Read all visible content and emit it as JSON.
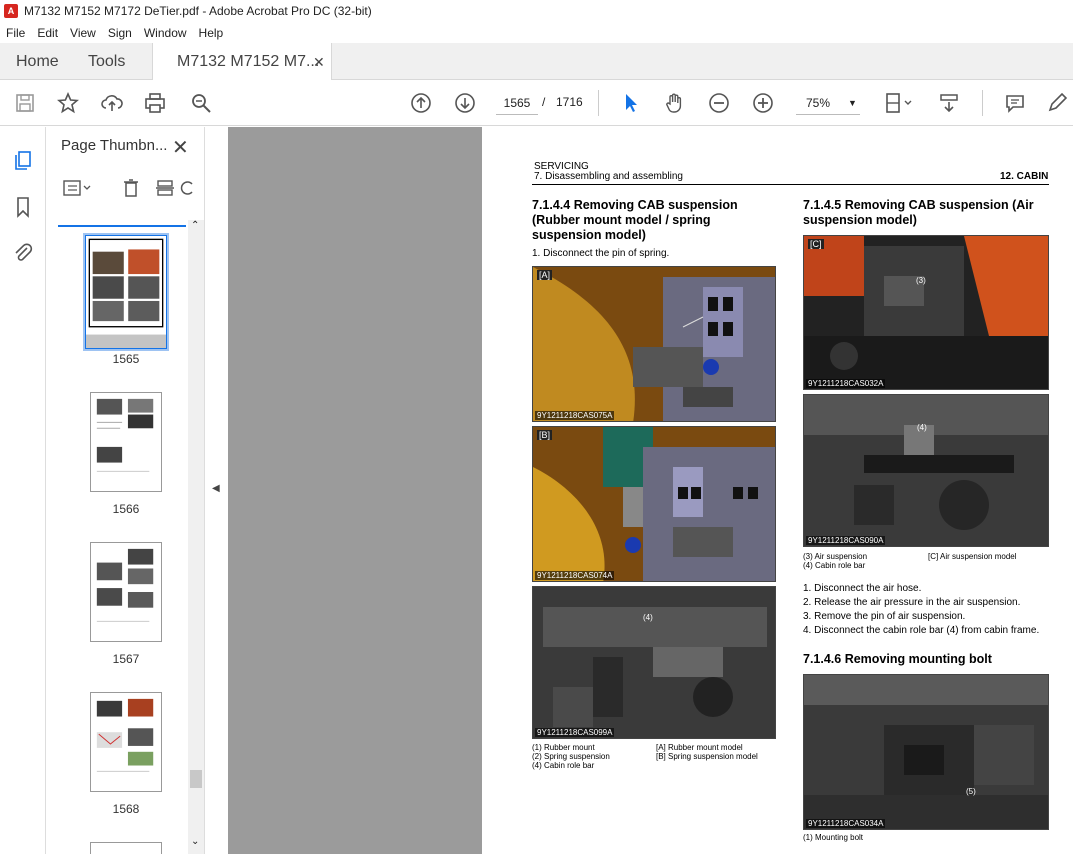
{
  "window": {
    "title": "M7132 M7152 M7172 DeTier.pdf - Adobe Acrobat Pro DC (32-bit)"
  },
  "menu": [
    "File",
    "Edit",
    "View",
    "Sign",
    "Window",
    "Help"
  ],
  "tabs": {
    "home": "Home",
    "tools": "Tools",
    "doc": "M7132 M7152 M7..."
  },
  "toolbar": {
    "current_page": "1565",
    "page_sep": "/",
    "total_pages": "1716",
    "zoom": "75%"
  },
  "panel": {
    "title": "Page Thumbn...",
    "thumbnails": [
      {
        "label": "1565"
      },
      {
        "label": "1566"
      },
      {
        "label": "1567"
      },
      {
        "label": "1568"
      }
    ]
  },
  "doc": {
    "header_left1": "SERVICING",
    "header_left2": "7. Disassembling and assembling",
    "header_right": "12. CABIN",
    "sec1_title": "7.1.4.4 Removing CAB suspension (Rubber mount model / spring suspension model)",
    "sec1_step": "1.   Disconnect the pin of spring.",
    "photoA": {
      "tag": "[A]",
      "code": "9Y1211218CAS075A"
    },
    "photoB": {
      "tag": "[B]",
      "code": "9Y1211218CAS074A"
    },
    "photoC1": {
      "tag": "",
      "code": "9Y1211218CAS099A",
      "callout": "(4)"
    },
    "legend1": [
      "(1)   Rubber mount",
      "(2)   Spring suspension",
      "(4)   Cabin role bar"
    ],
    "legend1b": [
      "[A]   Rubber mount model",
      "[B]   Spring suspension model"
    ],
    "sec2_title": "7.1.4.5 Removing CAB suspension (Air suspension model)",
    "photoC": {
      "tag": "[C]",
      "code": "9Y1211218CAS032A",
      "callout": "(3)"
    },
    "photoD": {
      "tag": "",
      "code": "9Y1211218CAS090A",
      "callout": "(4)"
    },
    "legend2": [
      "(3)   Air suspension",
      "(4)   Cabin role bar"
    ],
    "legend2b": [
      "[C]   Air suspension model"
    ],
    "steps2": [
      "1.   Disconnect the air hose.",
      "2.   Release the air pressure in the air suspension.",
      "3.   Remove the pin of air suspension.",
      "4.   Disconnect the cabin role bar (4) from cabin frame."
    ],
    "sec3_title": "7.1.4.6 Removing mounting bolt",
    "photoE": {
      "tag": "",
      "code": "9Y1211218CAS034A",
      "callout": "(5)"
    },
    "legend3": [
      "(1)   Mounting bolt"
    ]
  }
}
